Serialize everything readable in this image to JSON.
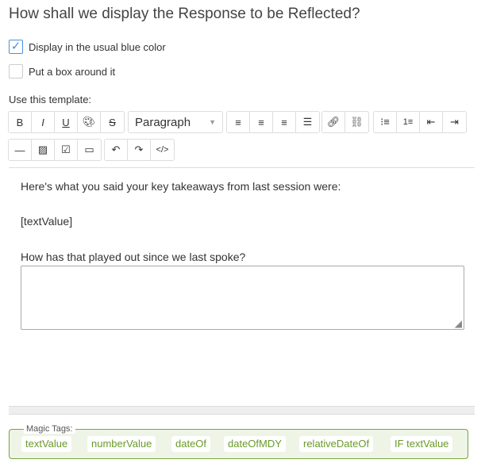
{
  "title": "How shall we display the Response to be Reflected?",
  "options": [
    {
      "label": "Display in the usual blue color",
      "checked": true
    },
    {
      "label": "Put a box around it",
      "checked": false
    }
  ],
  "template_label": "Use this template:",
  "toolbar": {
    "paragraph": "Paragraph",
    "buttons_row1a": [
      "bold-icon",
      "italic-icon",
      "underline-icon",
      "palette-icon",
      "strikethrough-icon"
    ],
    "buttons_row1b": [
      "align-left-icon",
      "align-center-icon",
      "align-right-icon",
      "align-justify-icon"
    ],
    "buttons_row1c": [
      "link-icon",
      "unlink-icon"
    ],
    "buttons_row1d": [
      "bullet-list-icon",
      "numbered-list-icon",
      "outdent-icon",
      "indent-icon"
    ],
    "buttons_row2a": [
      "horizontal-rule-icon",
      "image-icon",
      "checkbox-icon",
      "video-icon"
    ],
    "buttons_row2b": [
      "undo-icon",
      "redo-icon",
      "code-icon"
    ]
  },
  "editor": {
    "line1": "Here's what you said your key takeaways from last session were:",
    "line2": "[textValue]",
    "line3": "How has that played out since we last spoke?"
  },
  "magic_tags": {
    "legend": "Magic Tags:",
    "tags": [
      "textValue",
      "numberValue",
      "dateOf",
      "dateOfMDY",
      "relativeDateOf",
      "IF textValue"
    ],
    "color": "#6a9a2a"
  }
}
